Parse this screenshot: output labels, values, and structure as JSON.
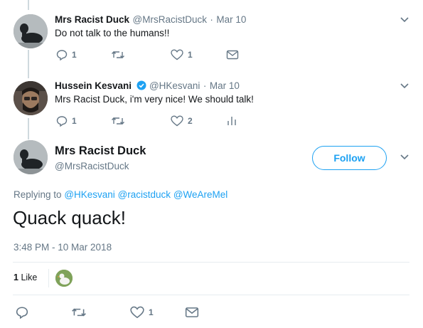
{
  "tweet1": {
    "name": "Mrs Racist Duck",
    "handle": "@MrsRacistDuck",
    "date": "Mar 10",
    "text": "Do not talk to the humans!!",
    "replies": "1",
    "likes": "1"
  },
  "tweet2": {
    "name": "Hussein Kesvani",
    "handle": "@HKesvani",
    "date": "Mar 10",
    "text": "Mrs Racist Duck, i'm very nice! We should talk!",
    "replies": "1",
    "likes": "2"
  },
  "main": {
    "name": "Mrs Racist Duck",
    "handle": "@MrsRacistDuck",
    "follow_label": "Follow",
    "replying_prefix": "Replying to",
    "mentions": [
      "@HKesvani",
      "@racistduck",
      "@WeAreMel"
    ],
    "text": "Quack quack!",
    "timestamp": "3:48 PM - 10 Mar 2018",
    "like_count": "1",
    "like_label": "Like",
    "action_likes": "1"
  },
  "separator": "·",
  "colors": {
    "accent": "#1da1f2",
    "muted": "#657786",
    "text": "#14171a",
    "line": "#cfd9de"
  }
}
